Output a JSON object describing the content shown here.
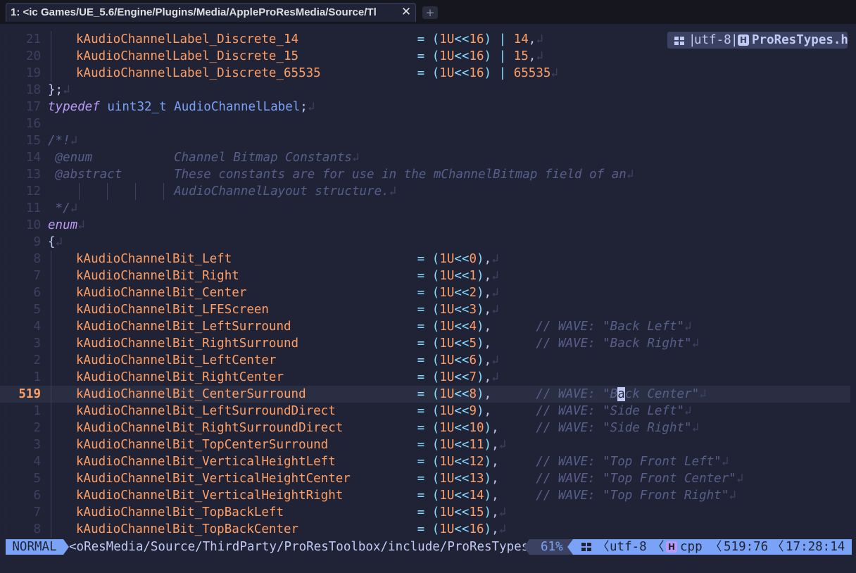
{
  "tab": {
    "title": "1: <ic Games/UE_5.6/Engine/Plugins/Media/AppleProResMedia/Source/Tl",
    "close": "✕",
    "new": "+"
  },
  "badge": {
    "sep": "|",
    "encoding": "utf-8",
    "file_icon": "H",
    "filename": "ProResTypes.h"
  },
  "colors": {
    "background": "#1f2335",
    "accent": "#7aa2f7",
    "orange": "#ff9e64",
    "cyan": "#89ddff",
    "purple": "#bb9af7",
    "comment": "#565f89",
    "current_line": "#292e42"
  },
  "editor": {
    "lines": [
      {
        "n": "21",
        "g": true,
        "t": [
          [
            "id",
            "kAudioChannelLabel_Discrete_14"
          ],
          [
            "pn",
            "                "
          ],
          [
            "op",
            "="
          ],
          [
            "pn",
            " "
          ],
          [
            "op",
            "("
          ],
          [
            "num",
            "1U"
          ],
          [
            "op",
            "<<"
          ],
          [
            "num",
            "16"
          ],
          [
            "op",
            ")"
          ],
          [
            "pn",
            " "
          ],
          [
            "op",
            "|"
          ],
          [
            "pn",
            " "
          ],
          [
            "num",
            "14"
          ],
          [
            "pn",
            ","
          ],
          [
            "nl",
            "↲"
          ]
        ]
      },
      {
        "n": "20",
        "g": true,
        "t": [
          [
            "id",
            "kAudioChannelLabel_Discrete_15"
          ],
          [
            "pn",
            "                "
          ],
          [
            "op",
            "="
          ],
          [
            "pn",
            " "
          ],
          [
            "op",
            "("
          ],
          [
            "num",
            "1U"
          ],
          [
            "op",
            "<<"
          ],
          [
            "num",
            "16"
          ],
          [
            "op",
            ")"
          ],
          [
            "pn",
            " "
          ],
          [
            "op",
            "|"
          ],
          [
            "pn",
            " "
          ],
          [
            "num",
            "15"
          ],
          [
            "pn",
            ","
          ],
          [
            "nl",
            "↲"
          ]
        ]
      },
      {
        "n": "19",
        "g": true,
        "t": [
          [
            "id",
            "kAudioChannelLabel_Discrete_65535"
          ],
          [
            "pn",
            "             "
          ],
          [
            "op",
            "="
          ],
          [
            "pn",
            " "
          ],
          [
            "op",
            "("
          ],
          [
            "num",
            "1U"
          ],
          [
            "op",
            "<<"
          ],
          [
            "num",
            "16"
          ],
          [
            "op",
            ")"
          ],
          [
            "pn",
            " "
          ],
          [
            "op",
            "|"
          ],
          [
            "pn",
            " "
          ],
          [
            "num",
            "65535"
          ],
          [
            "nl",
            "↲"
          ]
        ]
      },
      {
        "n": "18",
        "t": [
          [
            "pn",
            "};"
          ],
          [
            "nl",
            "↲"
          ]
        ]
      },
      {
        "n": "17",
        "t": [
          [
            "kw",
            "typedef"
          ],
          [
            "pn",
            " "
          ],
          [
            "ty",
            "uint32_t"
          ],
          [
            "pn",
            " "
          ],
          [
            "ty",
            "AudioChannelLabel"
          ],
          [
            "pn",
            ";"
          ],
          [
            "nl",
            "↲"
          ]
        ]
      },
      {
        "n": "16",
        "t": []
      },
      {
        "n": "15",
        "t": [
          [
            "cm",
            "/*!"
          ],
          [
            "nl",
            "↲"
          ]
        ]
      },
      {
        "n": "14",
        "t": [
          [
            "cm",
            " @enum           Channel Bitmap Constants"
          ],
          [
            "nl",
            "↲"
          ]
        ]
      },
      {
        "n": "13",
        "t": [
          [
            "cm",
            " @abstract       These constants are for use in the mChannelBitmap field of an"
          ],
          [
            "nl",
            "↲"
          ]
        ]
      },
      {
        "n": "12",
        "tg": true,
        "t": [
          [
            "cm",
            "                 AudioChannelLayout structure."
          ],
          [
            "nl",
            "↲"
          ]
        ]
      },
      {
        "n": "11",
        "t": [
          [
            "cm",
            " */"
          ],
          [
            "nl",
            "↲"
          ]
        ]
      },
      {
        "n": "10",
        "t": [
          [
            "kw",
            "enum"
          ],
          [
            "nl",
            "↲"
          ]
        ]
      },
      {
        "n": "9",
        "t": [
          [
            "pn",
            "{"
          ],
          [
            "nl",
            "↲"
          ]
        ]
      },
      {
        "n": "8",
        "g": true,
        "t": [
          [
            "id",
            "kAudioChannelBit_Left"
          ],
          [
            "pn",
            "                         "
          ],
          [
            "op",
            "="
          ],
          [
            "pn",
            " "
          ],
          [
            "op",
            "("
          ],
          [
            "num",
            "1U"
          ],
          [
            "op",
            "<<"
          ],
          [
            "num",
            "0"
          ],
          [
            "op",
            ")"
          ],
          [
            "pn",
            ","
          ],
          [
            "nl",
            "↲"
          ]
        ]
      },
      {
        "n": "7",
        "g": true,
        "t": [
          [
            "id",
            "kAudioChannelBit_Right"
          ],
          [
            "pn",
            "                        "
          ],
          [
            "op",
            "="
          ],
          [
            "pn",
            " "
          ],
          [
            "op",
            "("
          ],
          [
            "num",
            "1U"
          ],
          [
            "op",
            "<<"
          ],
          [
            "num",
            "1"
          ],
          [
            "op",
            ")"
          ],
          [
            "pn",
            ","
          ],
          [
            "nl",
            "↲"
          ]
        ]
      },
      {
        "n": "6",
        "g": true,
        "t": [
          [
            "id",
            "kAudioChannelBit_Center"
          ],
          [
            "pn",
            "                       "
          ],
          [
            "op",
            "="
          ],
          [
            "pn",
            " "
          ],
          [
            "op",
            "("
          ],
          [
            "num",
            "1U"
          ],
          [
            "op",
            "<<"
          ],
          [
            "num",
            "2"
          ],
          [
            "op",
            ")"
          ],
          [
            "pn",
            ","
          ],
          [
            "nl",
            "↲"
          ]
        ]
      },
      {
        "n": "5",
        "g": true,
        "t": [
          [
            "id",
            "kAudioChannelBit_LFEScreen"
          ],
          [
            "pn",
            "                    "
          ],
          [
            "op",
            "="
          ],
          [
            "pn",
            " "
          ],
          [
            "op",
            "("
          ],
          [
            "num",
            "1U"
          ],
          [
            "op",
            "<<"
          ],
          [
            "num",
            "3"
          ],
          [
            "op",
            ")"
          ],
          [
            "pn",
            ","
          ],
          [
            "nl",
            "↲"
          ]
        ]
      },
      {
        "n": "4",
        "g": true,
        "t": [
          [
            "id",
            "kAudioChannelBit_LeftSurround"
          ],
          [
            "pn",
            "                 "
          ],
          [
            "op",
            "="
          ],
          [
            "pn",
            " "
          ],
          [
            "op",
            "("
          ],
          [
            "num",
            "1U"
          ],
          [
            "op",
            "<<"
          ],
          [
            "num",
            "4"
          ],
          [
            "op",
            ")"
          ],
          [
            "pn",
            ",      "
          ],
          [
            "cm",
            "// WAVE: \"Back Left\""
          ],
          [
            "nl",
            "↲"
          ]
        ]
      },
      {
        "n": "3",
        "g": true,
        "t": [
          [
            "id",
            "kAudioChannelBit_RightSurround"
          ],
          [
            "pn",
            "                "
          ],
          [
            "op",
            "="
          ],
          [
            "pn",
            " "
          ],
          [
            "op",
            "("
          ],
          [
            "num",
            "1U"
          ],
          [
            "op",
            "<<"
          ],
          [
            "num",
            "5"
          ],
          [
            "op",
            ")"
          ],
          [
            "pn",
            ",      "
          ],
          [
            "cm",
            "// WAVE: \"Back Right\""
          ],
          [
            "nl",
            "↲"
          ]
        ]
      },
      {
        "n": "2",
        "g": true,
        "t": [
          [
            "id",
            "kAudioChannelBit_LeftCenter"
          ],
          [
            "pn",
            "                   "
          ],
          [
            "op",
            "="
          ],
          [
            "pn",
            " "
          ],
          [
            "op",
            "("
          ],
          [
            "num",
            "1U"
          ],
          [
            "op",
            "<<"
          ],
          [
            "num",
            "6"
          ],
          [
            "op",
            ")"
          ],
          [
            "pn",
            ","
          ],
          [
            "nl",
            "↲"
          ]
        ]
      },
      {
        "n": "1",
        "g": true,
        "t": [
          [
            "id",
            "kAudioChannelBit_RightCenter"
          ],
          [
            "pn",
            "                  "
          ],
          [
            "op",
            "="
          ],
          [
            "pn",
            " "
          ],
          [
            "op",
            "("
          ],
          [
            "num",
            "1U"
          ],
          [
            "op",
            "<<"
          ],
          [
            "num",
            "7"
          ],
          [
            "op",
            ")"
          ],
          [
            "pn",
            ","
          ],
          [
            "nl",
            "↲"
          ]
        ]
      },
      {
        "n": "519",
        "current": true,
        "g": true,
        "t": [
          [
            "id",
            "kAudioChannelBit_CenterSurround"
          ],
          [
            "pn",
            "               "
          ],
          [
            "op",
            "="
          ],
          [
            "pn",
            " "
          ],
          [
            "op",
            "("
          ],
          [
            "num",
            "1U"
          ],
          [
            "op",
            "<<"
          ],
          [
            "num",
            "8"
          ],
          [
            "op",
            ")"
          ],
          [
            "pn",
            ",      "
          ],
          [
            "cm",
            "// WAVE: \"B"
          ],
          [
            "cur",
            "a"
          ],
          [
            "cm",
            "ck Center\""
          ],
          [
            "nl",
            "↲"
          ]
        ]
      },
      {
        "n": "1",
        "g": true,
        "t": [
          [
            "id",
            "kAudioChannelBit_LeftSurroundDirect"
          ],
          [
            "pn",
            "           "
          ],
          [
            "op",
            "="
          ],
          [
            "pn",
            " "
          ],
          [
            "op",
            "("
          ],
          [
            "num",
            "1U"
          ],
          [
            "op",
            "<<"
          ],
          [
            "num",
            "9"
          ],
          [
            "op",
            ")"
          ],
          [
            "pn",
            ",      "
          ],
          [
            "cm",
            "// WAVE: \"Side Left\""
          ],
          [
            "nl",
            "↲"
          ]
        ]
      },
      {
        "n": "2",
        "g": true,
        "t": [
          [
            "id",
            "kAudioChannelBit_RightSurroundDirect"
          ],
          [
            "pn",
            "          "
          ],
          [
            "op",
            "="
          ],
          [
            "pn",
            " "
          ],
          [
            "op",
            "("
          ],
          [
            "num",
            "1U"
          ],
          [
            "op",
            "<<"
          ],
          [
            "num",
            "10"
          ],
          [
            "op",
            ")"
          ],
          [
            "pn",
            ",     "
          ],
          [
            "cm",
            "// WAVE: \"Side Right\""
          ],
          [
            "nl",
            "↲"
          ]
        ]
      },
      {
        "n": "3",
        "g": true,
        "t": [
          [
            "id",
            "kAudioChannelBit_TopCenterSurround"
          ],
          [
            "pn",
            "            "
          ],
          [
            "op",
            "="
          ],
          [
            "pn",
            " "
          ],
          [
            "op",
            "("
          ],
          [
            "num",
            "1U"
          ],
          [
            "op",
            "<<"
          ],
          [
            "num",
            "11"
          ],
          [
            "op",
            ")"
          ],
          [
            "pn",
            ","
          ],
          [
            "nl",
            "↲"
          ]
        ]
      },
      {
        "n": "4",
        "g": true,
        "t": [
          [
            "id",
            "kAudioChannelBit_VerticalHeightLeft"
          ],
          [
            "pn",
            "           "
          ],
          [
            "op",
            "="
          ],
          [
            "pn",
            " "
          ],
          [
            "op",
            "("
          ],
          [
            "num",
            "1U"
          ],
          [
            "op",
            "<<"
          ],
          [
            "num",
            "12"
          ],
          [
            "op",
            ")"
          ],
          [
            "pn",
            ",     "
          ],
          [
            "cm",
            "// WAVE: \"Top Front Left\""
          ],
          [
            "nl",
            "↲"
          ]
        ]
      },
      {
        "n": "5",
        "g": true,
        "t": [
          [
            "id",
            "kAudioChannelBit_VerticalHeightCenter"
          ],
          [
            "pn",
            "         "
          ],
          [
            "op",
            "="
          ],
          [
            "pn",
            " "
          ],
          [
            "op",
            "("
          ],
          [
            "num",
            "1U"
          ],
          [
            "op",
            "<<"
          ],
          [
            "num",
            "13"
          ],
          [
            "op",
            ")"
          ],
          [
            "pn",
            ",     "
          ],
          [
            "cm",
            "// WAVE: \"Top Front Center\""
          ],
          [
            "nl",
            "↲"
          ]
        ]
      },
      {
        "n": "6",
        "g": true,
        "t": [
          [
            "id",
            "kAudioChannelBit_VerticalHeightRight"
          ],
          [
            "pn",
            "          "
          ],
          [
            "op",
            "="
          ],
          [
            "pn",
            " "
          ],
          [
            "op",
            "("
          ],
          [
            "num",
            "1U"
          ],
          [
            "op",
            "<<"
          ],
          [
            "num",
            "14"
          ],
          [
            "op",
            ")"
          ],
          [
            "pn",
            ",     "
          ],
          [
            "cm",
            "// WAVE: \"Top Front Right\""
          ],
          [
            "nl",
            "↲"
          ]
        ]
      },
      {
        "n": "7",
        "g": true,
        "t": [
          [
            "id",
            "kAudioChannelBit_TopBackLeft"
          ],
          [
            "pn",
            "                  "
          ],
          [
            "op",
            "="
          ],
          [
            "pn",
            " "
          ],
          [
            "op",
            "("
          ],
          [
            "num",
            "1U"
          ],
          [
            "op",
            "<<"
          ],
          [
            "num",
            "15"
          ],
          [
            "op",
            ")"
          ],
          [
            "pn",
            ","
          ],
          [
            "nl",
            "↲"
          ]
        ]
      },
      {
        "n": "8",
        "g": true,
        "t": [
          [
            "id",
            "kAudioChannelBit_TopBackCenter"
          ],
          [
            "pn",
            "                "
          ],
          [
            "op",
            "="
          ],
          [
            "pn",
            " "
          ],
          [
            "op",
            "("
          ],
          [
            "num",
            "1U"
          ],
          [
            "op",
            "<<"
          ],
          [
            "num",
            "16"
          ],
          [
            "op",
            ")"
          ],
          [
            "pn",
            ","
          ],
          [
            "nl",
            "↲"
          ]
        ]
      }
    ]
  },
  "status": {
    "mode": "NORMAL",
    "path": "<oResMedia/Source/ThirdParty/ProResToolbox/include/ProResTypes.h",
    "percent": "61%",
    "encoding": "utf-8",
    "filetype_icon": "H",
    "filetype": "cpp",
    "position": "519:76",
    "time": "17:28:14",
    "separator": "〈"
  }
}
